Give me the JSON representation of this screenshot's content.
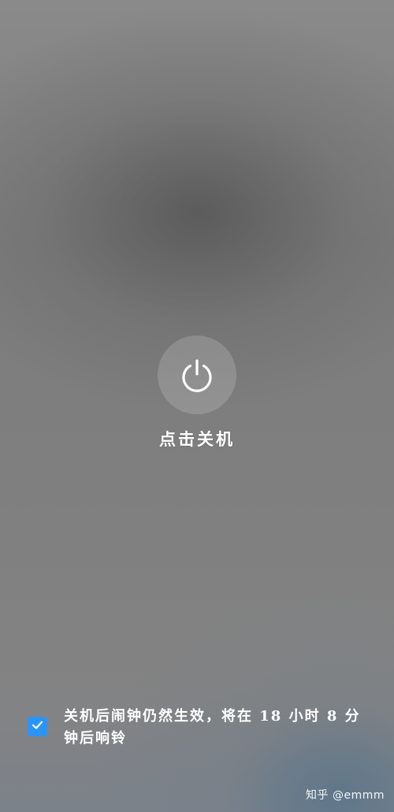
{
  "power": {
    "icon": "power-icon",
    "label": "点击关机"
  },
  "alarm_option": {
    "checked": true,
    "icon": "check-icon",
    "accent_color": "#2b95f6",
    "text": "关机后闹钟仍然生效，将在 18 小时 8 分钟后响铃"
  },
  "watermark": {
    "text": "知乎 @emmm"
  }
}
